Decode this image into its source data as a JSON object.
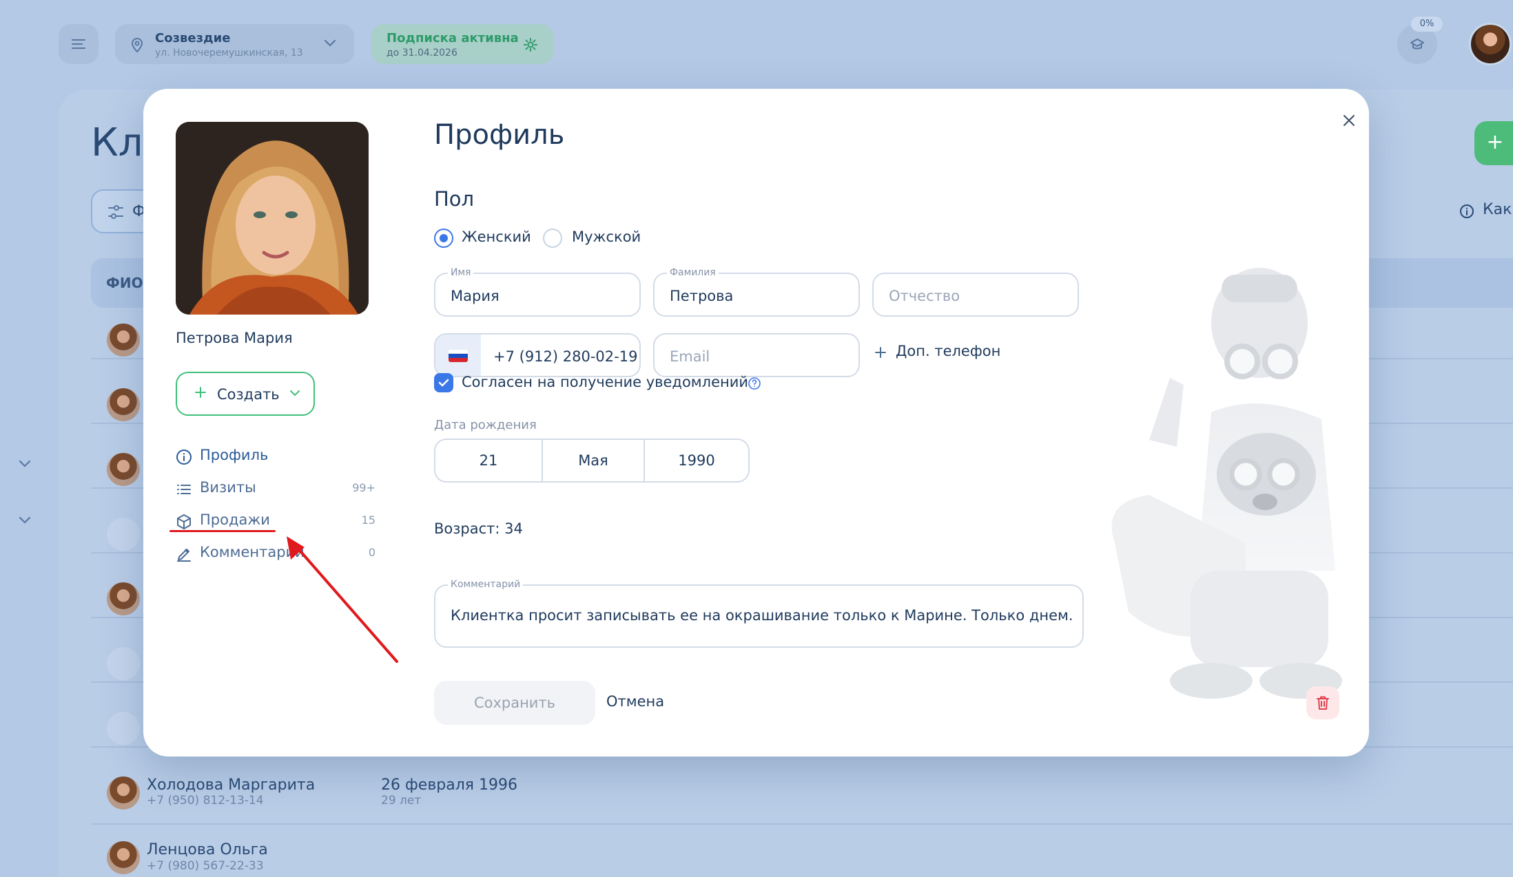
{
  "topbar": {
    "location_title": "Созвездие",
    "location_sub": "ул. Новочеремушкинская, 13",
    "subscription_title": "Подписка активна",
    "subscription_sub": "до 31.04.2026",
    "progress_badge": "0%"
  },
  "background_page": {
    "title": "Кл",
    "filter_label": "Ф",
    "how_label": "Как",
    "table_header": "ФИО",
    "add_label": "+",
    "rows": [
      {
        "name": "Холодова Маргарита",
        "phone": "+7 (950) 812-13-14",
        "date": "26 февраля 1996",
        "age": "29 лет"
      },
      {
        "name": "Ленцова Ольга",
        "phone": "+7 (980) 567-22-33",
        "date": "",
        "age": ""
      }
    ]
  },
  "sidebar": {
    "person_name": "Петрова Мария",
    "create_label": "Создать",
    "nav": [
      {
        "label": "Профиль",
        "count": ""
      },
      {
        "label": "Визиты",
        "count": "99+"
      },
      {
        "label": "Продажи",
        "count": "15"
      },
      {
        "label": "Комментарии",
        "count": "0"
      }
    ]
  },
  "profile": {
    "title": "Профиль",
    "gender_title": "Пол",
    "gender_options": [
      "Женский",
      "Мужской"
    ],
    "gender_selected": "Женский",
    "first_name_label": "Имя",
    "first_name": "Мария",
    "last_name_label": "Фамилия",
    "last_name": "Петрова",
    "patronymic_placeholder": "Отчество",
    "phone": "+7 (912) 280-02-19",
    "email_placeholder": "Email",
    "add_phone_label": "Доп. телефон",
    "consent_label": "Согласен на получение уведомлений",
    "consent_checked": true,
    "dob_label": "Дата рождения",
    "dob_day": "21",
    "dob_month": "Мая",
    "dob_year": "1990",
    "age": "Возраст: 34",
    "comment_label": "Комментарий",
    "comment": "Клиентка просит записывать ее на окрашивание только к Марине. Только днем.",
    "save_label": "Сохранить",
    "cancel_label": "Отмена"
  },
  "colors": {
    "accent": "#3b78e7",
    "green": "#3fbf7a",
    "annotation_red": "#e0191d",
    "danger_bg": "#fde7e9"
  }
}
